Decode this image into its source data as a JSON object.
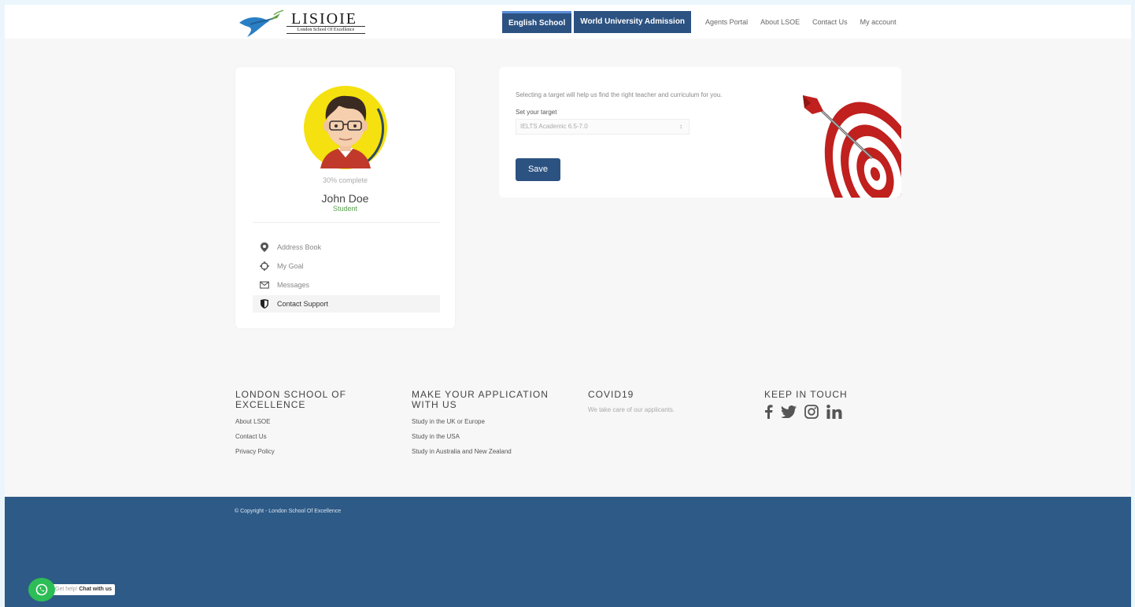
{
  "header": {
    "logo_title": "LISIOIE",
    "logo_subtitle": "London School Of Excellence",
    "nav_buttons": [
      "English School",
      "World University Admission"
    ],
    "nav_links": [
      "Agents Portal",
      "About LSOE",
      "Contact Us",
      "My account"
    ]
  },
  "profile": {
    "completion": "30% complete",
    "name": "John Doe",
    "role": "Student",
    "completion_value": 0.3,
    "menu": [
      {
        "label": "Address Book",
        "icon": "map-pin-icon"
      },
      {
        "label": "My Goal",
        "icon": "crosshair-icon"
      },
      {
        "label": "Messages",
        "icon": "envelope-icon"
      },
      {
        "label": "Contact Support",
        "icon": "shield-icon"
      }
    ]
  },
  "target": {
    "description": "Selecting a target will help us find the right teacher and curriculum for you.",
    "label": "Set your target",
    "selected": "IELTS Academic 6.5-7.0",
    "save_label": "Save"
  },
  "footer": {
    "col1": {
      "heading": "LONDON SCHOOL OF EXCELLENCE",
      "links": [
        "About LSOE",
        "Contact Us",
        "Privacy Policy"
      ]
    },
    "col2": {
      "heading": "MAKE YOUR APPLICATION WITH US",
      "links": [
        "Study in the UK or Europe",
        "Study in the USA",
        "Study in Australia and New Zealand"
      ]
    },
    "col3": {
      "heading": "COVID19",
      "text": "We take care of our applicants."
    },
    "col4": {
      "heading": "KEEP IN TOUCH",
      "icons": [
        "facebook-icon",
        "twitter-icon",
        "instagram-icon",
        "linkedin-icon"
      ]
    },
    "copyright": "© Copyright - London School Of Excellence"
  },
  "chat": {
    "prefix": "Get help!",
    "label": "Chat with us"
  },
  "colors": {
    "primary": "#2c5282",
    "footer": "#2e5a87",
    "accent_green": "#59a14f",
    "whatsapp": "#2dbd56"
  }
}
